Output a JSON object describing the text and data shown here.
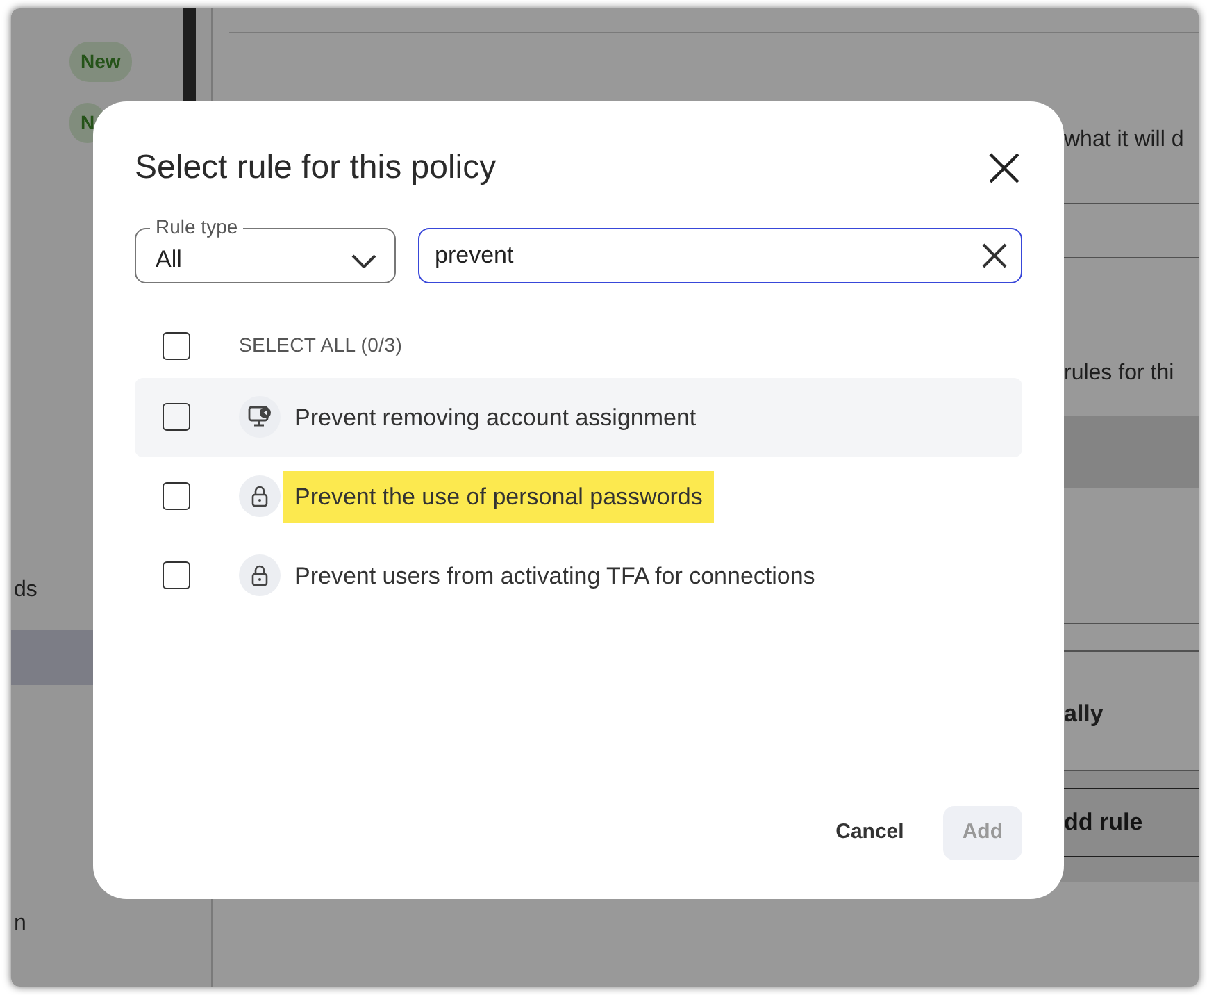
{
  "background": {
    "badges": [
      "New",
      "N"
    ],
    "sidebar_items": [
      {
        "label": "ds",
        "selected": false
      },
      {
        "selected": true
      },
      {
        "label": "n",
        "selected": false
      }
    ],
    "main_texts": [
      "what it will d",
      "rules for thi",
      "ally"
    ],
    "add_rule_button": "dd rule"
  },
  "dialog": {
    "title": "Select rule for this policy",
    "rule_type": {
      "label": "Rule type",
      "value": "All"
    },
    "search": {
      "value": "prevent"
    },
    "select_all": {
      "label": "SELECT ALL (0/3)",
      "checked": false
    },
    "rules": [
      {
        "label": "Prevent removing account assignment",
        "kind": "monitor",
        "checked": false,
        "hovered": true,
        "highlighted": false
      },
      {
        "label": "Prevent the use of personal passwords",
        "kind": "lock",
        "checked": false,
        "hovered": false,
        "highlighted": true
      },
      {
        "label": "Prevent users from activating TFA for connections",
        "kind": "lock",
        "checked": false,
        "hovered": false,
        "highlighted": false
      }
    ],
    "buttons": [
      {
        "label": "Cancel",
        "kind": "text",
        "disabled": false
      },
      {
        "label": "Add",
        "kind": "filled",
        "disabled": true
      }
    ]
  }
}
